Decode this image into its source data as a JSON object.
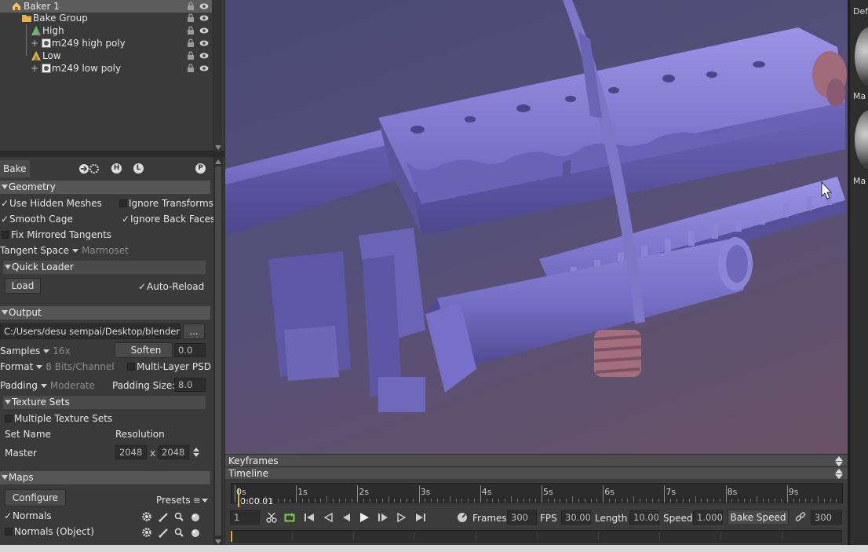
{
  "tree": {
    "items": [
      {
        "label": "Baker 1",
        "icon": "baker-icon"
      },
      {
        "label": "Bake Group",
        "icon": "folder-icon"
      },
      {
        "label": "High",
        "icon": "high-poly-icon"
      },
      {
        "label": "m249 high poly",
        "icon": "mesh-icon"
      },
      {
        "label": "Low",
        "icon": "low-poly-icon"
      },
      {
        "label": "m249 low poly",
        "icon": "mesh-icon"
      }
    ]
  },
  "toolbar": {
    "bake_label": "Bake",
    "h_label": "H",
    "l_label": "L",
    "p_label": "P"
  },
  "geometry": {
    "header": "Geometry",
    "use_hidden_meshes": "Use Hidden Meshes",
    "ignore_transforms": "Ignore Transforms",
    "smooth_cage": "Smooth Cage",
    "ignore_back_faces": "Ignore Back Faces",
    "fix_mirrored_tangents": "Fix Mirrored Tangents",
    "tangent_space_label": "Tangent Space",
    "tangent_space_value": "Marmoset"
  },
  "quick_loader": {
    "header": "Quick Loader",
    "load_label": "Load",
    "auto_reload": "Auto-Reload"
  },
  "output": {
    "header": "Output",
    "path": "C:/Users/desu sempai/Desktop/blender/ba",
    "browse_label": "...",
    "samples_label": "Samples",
    "samples_value": "16x",
    "soften_label": "Soften",
    "soften_value": "0.0",
    "format_label": "Format",
    "format_value": "8 Bits/Channel",
    "multilayer_psd": "Multi-Layer PSD",
    "padding_label": "Padding",
    "padding_value": "Moderate",
    "padding_size_label": "Padding Size:",
    "padding_size_value": "8.0"
  },
  "texture_sets": {
    "header": "Texture Sets",
    "multiple_label": "Multiple Texture Sets",
    "col_set_name": "Set Name",
    "col_resolution": "Resolution",
    "row_name": "Master",
    "res_w": "2048",
    "res_x": "x",
    "res_h": "2048"
  },
  "maps": {
    "header": "Maps",
    "configure_label": "Configure",
    "presets_label": "Presets",
    "items": [
      {
        "label": "Normals"
      },
      {
        "label": "Normals (Object)"
      }
    ]
  },
  "materials": {
    "label1": "Def",
    "label2": "Ma",
    "label3": "Ma"
  },
  "timeline": {
    "keyframes_label": "Keyframes",
    "timeline_label": "Timeline",
    "current_time": "0:00.01",
    "ticks": [
      "0s",
      "1s",
      "2s",
      "3s",
      "4s",
      "5s",
      "6s",
      "7s",
      "8s",
      "9s"
    ],
    "frame_value": "1",
    "frames_label": "Frames",
    "frames_value": "300",
    "fps_label": "FPS",
    "fps_value": "30.000",
    "length_label": "Length",
    "length_value": "10.000",
    "speed_label": "Speed",
    "speed_value": "1.000",
    "bake_speed_label": "Bake Speed",
    "bake_speed_value": "300"
  },
  "colors": {
    "accent": "#e0b030",
    "viewport_mesh": "#7a74c8",
    "panel_bg": "#3a3a3a"
  }
}
